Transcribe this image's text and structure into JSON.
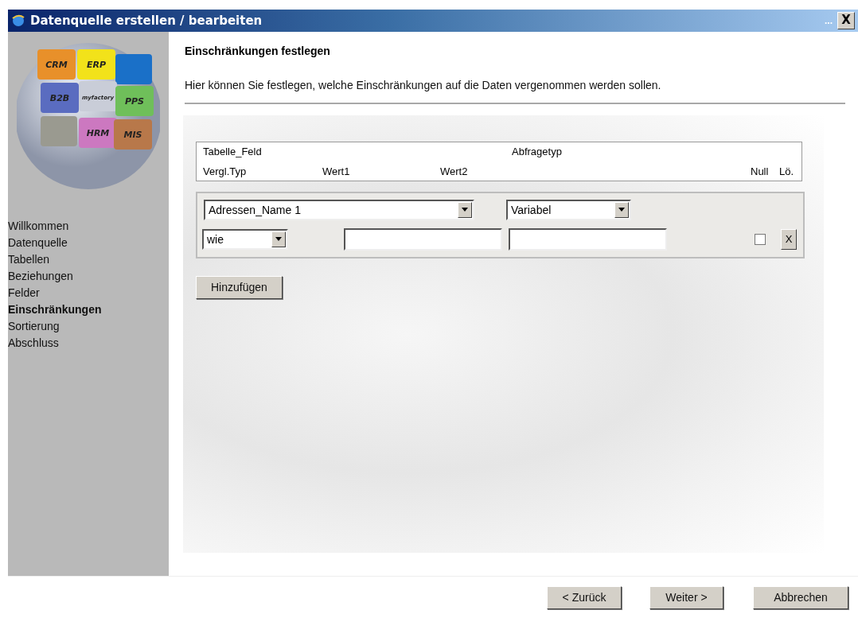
{
  "window": {
    "title": "Datenquelle erstellen / bearbeiten",
    "overflow": "...",
    "close": "X"
  },
  "logo": {
    "labels": [
      {
        "text": "CRM",
        "color": "#e8902a"
      },
      {
        "text": "ERP",
        "color": "#f2e21a"
      },
      {
        "text": "B2B",
        "color": "#5a6cc0"
      },
      {
        "text": "myfactory",
        "color": "#c9cdd8"
      },
      {
        "text": "PPS",
        "color": "#6fbf5a"
      },
      {
        "text": "HRM",
        "color": "#cc78c0"
      },
      {
        "text": "MIS",
        "color": "#b8784a"
      }
    ]
  },
  "sidebar": {
    "items": [
      {
        "label": "Willkommen",
        "selected": false
      },
      {
        "label": "Datenquelle",
        "selected": false
      },
      {
        "label": "Tabellen",
        "selected": false
      },
      {
        "label": "Beziehungen",
        "selected": false
      },
      {
        "label": "Felder",
        "selected": false
      },
      {
        "label": "Einschränkungen",
        "selected": true
      },
      {
        "label": "Sortierung",
        "selected": false
      },
      {
        "label": "Abschluss",
        "selected": false
      }
    ]
  },
  "heading": "Einschränkungen festlegen",
  "description": "Hier können Sie festlegen, welche Einschränkungen auf die Daten vergenommen werden sollen.",
  "header": {
    "row_1": [
      "Tabelle_Feld",
      "Abfragetyp"
    ],
    "row_2": [
      "Vergl.Typ",
      "Wert1",
      "Wert2"
    ],
    "null": "Null",
    "delete": "Lö."
  },
  "constraints": [
    {
      "field": "Adressen_Name 1",
      "query_type": "Variabel",
      "comparison": "wie",
      "null_checked": false,
      "delete": "X"
    }
  ],
  "add_button": "Hinzufügen",
  "footer": {
    "buttons": [
      "< Zurück",
      "Weiter >",
      "Abbrechen"
    ]
  }
}
